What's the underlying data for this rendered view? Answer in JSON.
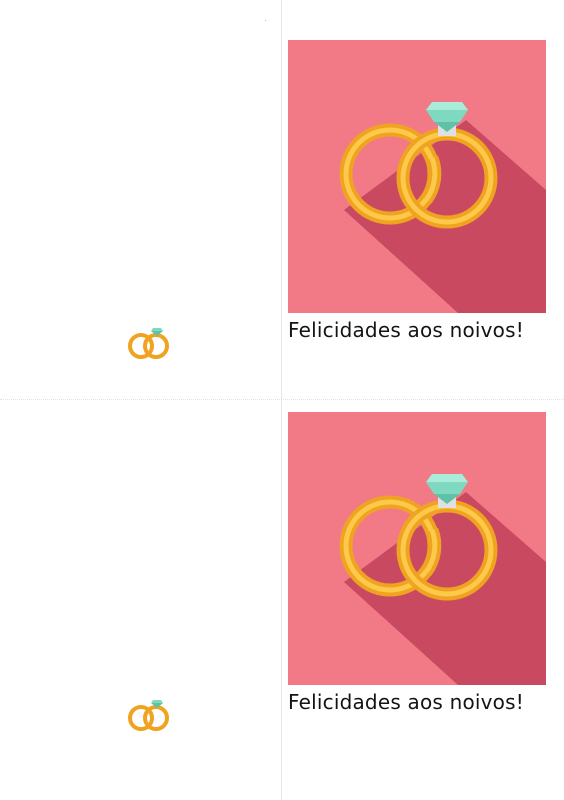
{
  "cards": [
    {
      "greeting": "Felicidades aos noivos!",
      "art_icon": "wedding-rings-icon",
      "back_icon": "wedding-rings-icon"
    },
    {
      "greeting": "Felicidades aos noivos!",
      "art_icon": "wedding-rings-icon",
      "back_icon": "wedding-rings-icon"
    }
  ],
  "colors": {
    "art_background": "#f17a86",
    "art_shadow": "#c94a60",
    "ring_gold": "#f5b12e",
    "ring_highlight": "#fcd15a",
    "gem": "#7fd9c0",
    "text": "#141414"
  }
}
